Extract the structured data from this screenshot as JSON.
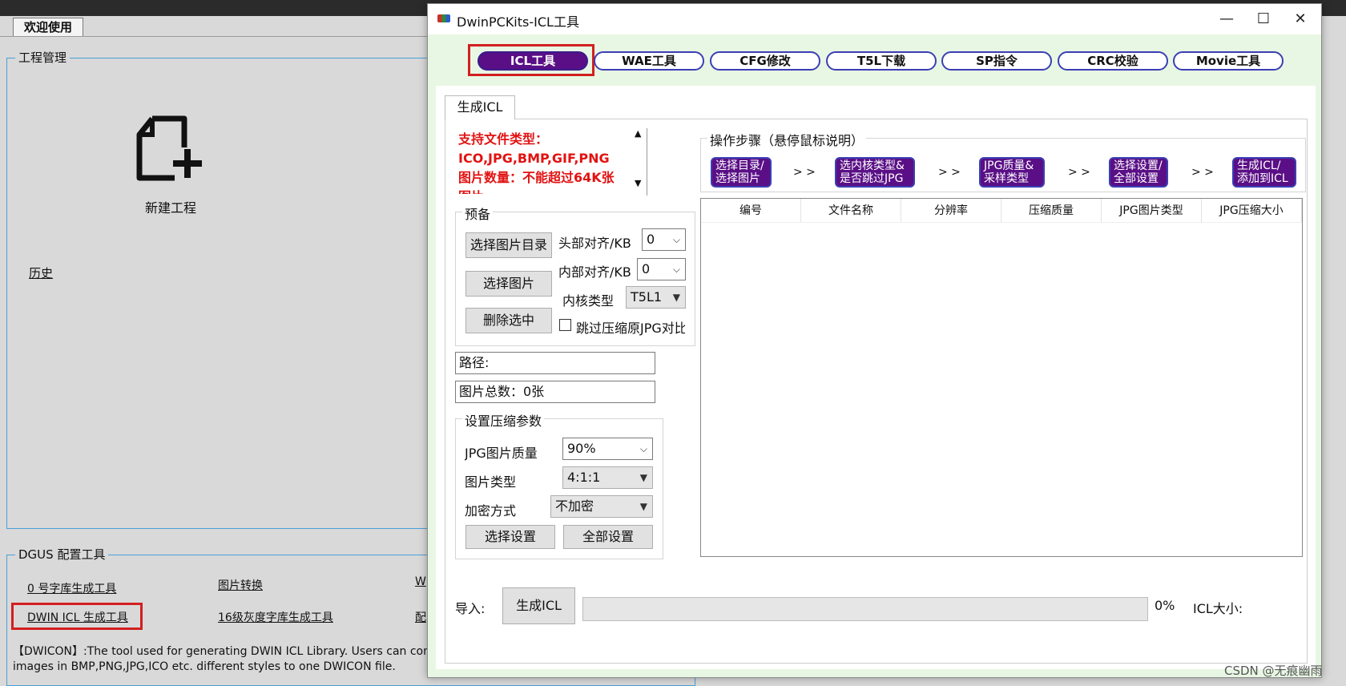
{
  "background_app": {
    "tab_label": "欢迎使用",
    "project_group_title": "工程管理",
    "new_project_label": "新建工程",
    "history_label": "历史",
    "dgus_group_title": "DGUS 配置工具",
    "links": {
      "font0": "0 号字库生成工具",
      "image_convert": "图片转换",
      "w_partial": "W",
      "dwin_icl": "DWIN ICL 生成工具",
      "gray16": "16级灰度字库生成工具",
      "config_partial": "配"
    },
    "description_line1": "【DWICON】:The tool used for generating DWIN ICL Library. Users can con",
    "description_line2": "images in BMP,PNG,JPG,ICO etc. different styles to one DWICON file."
  },
  "window": {
    "title": "DwinPCKits-ICL工具",
    "controls": {
      "minimize": "—",
      "maximize": "☐",
      "close": "✕"
    }
  },
  "tool_tabs": [
    {
      "label": "ICL工具",
      "active": true
    },
    {
      "label": "WAE工具"
    },
    {
      "label": "CFG修改"
    },
    {
      "label": "T5L下载"
    },
    {
      "label": "SP指令"
    },
    {
      "label": "CRC校验"
    },
    {
      "label": "Movie工具"
    }
  ],
  "panel": {
    "tab_label": "生成ICL",
    "support_text": {
      "line1": "支持文件类型：",
      "line2": "ICO,JPG,BMP,GIF,PNG",
      "line3": "图片数量：不能超过64K张",
      "line4": "图片"
    },
    "prep": {
      "title": "预备",
      "select_dir_button": "选择图片目录",
      "select_image_button": "选择图片",
      "delete_selected_button": "删除选中",
      "header_align_label": "头部对齐/KB",
      "header_align_value": "0",
      "inner_align_label": "内部对齐/KB",
      "inner_align_value": "0",
      "core_type_label": "内核类型",
      "core_type_value": "T5L1",
      "skip_jpg_label": "跳过压缩原JPG对比"
    },
    "path_label": "路径:",
    "total_label": "图片总数：0张",
    "compress": {
      "title": "设置压缩参数",
      "quality_label": "JPG图片质量",
      "quality_value": "90%",
      "image_type_label": "图片类型",
      "image_type_value": "4:1:1",
      "encrypt_label": "加密方式",
      "encrypt_value": "不加密",
      "select_settings_button": "选择设置",
      "all_settings_button": "全部设置"
    },
    "steps": {
      "title": "操作步骤（悬停鼠标说明）",
      "arrow": "> >",
      "items": [
        {
          "line1": "选择目录/",
          "line2": "选择图片"
        },
        {
          "line1": "选内核类型&",
          "line2": "是否跳过JPG"
        },
        {
          "line1": "JPG质量&",
          "line2": "采样类型"
        },
        {
          "line1": "选择设置/",
          "line2": "全部设置"
        },
        {
          "line1": "生成ICL/",
          "line2": "添加到ICL"
        }
      ]
    },
    "table_columns": [
      "编号",
      "文件名称",
      "分辨率",
      "压缩质量",
      "JPG图片类型",
      "JPG压缩大小"
    ],
    "bottom": {
      "import_label": "导入:",
      "generate_button": "生成ICL",
      "progress_value": 0,
      "progress_text": "0%",
      "icl_size_label": "ICL大小:"
    }
  },
  "watermark": "CSDN @无痕幽雨"
}
